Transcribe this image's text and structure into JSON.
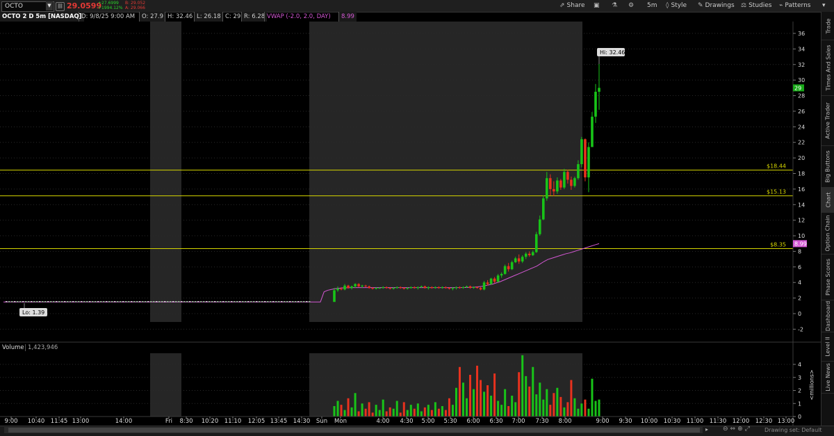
{
  "toolbar": {
    "symbol": "OCTO",
    "last_price": "29.0599",
    "net_change": "+27.6999",
    "net_change_pct": "+1994.12%",
    "bid": "B: 29.052",
    "ask": "A: 29.066",
    "share_label": "Share",
    "timeframe_label": "5m",
    "style_label": "Style",
    "drawings_label": "Drawings",
    "studies_label": "Studies",
    "patterns_label": "Patterns"
  },
  "info": {
    "title": "OCTO 2 D 5m [NASDAQ]",
    "datetime": "D: 9/8/25 9:00 AM",
    "open": "O: 27.9",
    "high": "H: 32.46",
    "low": "L: 26.18",
    "close": "C: 29",
    "range": "R: 6.28",
    "vwap_label": "VWAP (-2.0, 2.0, DAY)",
    "vwap_value": "8.99"
  },
  "right_tabs": [
    "Trade",
    "Times And Sales",
    "Active Trader",
    "Big Buttons",
    "Chart",
    "Option Chain",
    "Phase Scores",
    "Dashboard",
    "Level II",
    "Live News"
  ],
  "active_tab": "Chart",
  "colors": {
    "up": "#18c418",
    "down": "#e8321e",
    "vwap": "#d457d4",
    "level": "#d6d600",
    "grid": "#2a2a2a",
    "shade": "#262626"
  },
  "chart_data": {
    "type": "candlestick",
    "symbol": "OCTO",
    "timeframe": "2 D 5m",
    "ylim": [
      -3,
      37
    ],
    "y_ticks": [
      "-2",
      "0",
      "2",
      "4",
      "6",
      "8",
      "10",
      "12",
      "14",
      "16",
      "18",
      "20",
      "22",
      "24",
      "26",
      "28",
      "30",
      "32",
      "34",
      "36"
    ],
    "x_ticks": [
      "9:00",
      "10:40",
      "11:45",
      "13:00",
      "14:00",
      "Fri",
      "8:30",
      "10:20",
      "11:10",
      "12:05",
      "13:45",
      "14:30",
      "Sun",
      "Mon",
      "4:00",
      "4:30",
      "5:00",
      "5:30",
      "6:00",
      "6:30",
      "7:00",
      "7:30",
      "8:00",
      "9:00",
      "9:30",
      "10:00",
      "10:30",
      "11:00",
      "11:30",
      "12:00",
      "12:30",
      "13:00"
    ],
    "price_levels": [
      {
        "label": "$18.44",
        "value": 18.44
      },
      {
        "label": "$15.13",
        "value": 15.13
      },
      {
        "label": "$8.35",
        "value": 8.35
      }
    ],
    "current_price_label": "29",
    "vwap_label": "8.99",
    "high_label": "Hi: 32.46",
    "low_label": "Lo: 1.39",
    "candles": [
      [
        1.5,
        3.3,
        1.6,
        3.0
      ],
      [
        3.0,
        3.5,
        2.8,
        3.2
      ],
      [
        3.2,
        3.4,
        3.0,
        3.1
      ],
      [
        3.1,
        3.8,
        3.0,
        3.6
      ],
      [
        3.6,
        3.7,
        3.2,
        3.3
      ],
      [
        3.3,
        3.6,
        3.1,
        3.5
      ],
      [
        3.5,
        3.9,
        3.3,
        3.8
      ],
      [
        3.8,
        3.9,
        3.4,
        3.5
      ],
      [
        3.5,
        3.7,
        3.3,
        3.6
      ],
      [
        3.6,
        3.7,
        3.4,
        3.5
      ],
      [
        3.5,
        3.6,
        3.2,
        3.3
      ],
      [
        3.3,
        3.4,
        3.1,
        3.2
      ],
      [
        3.2,
        3.4,
        3.1,
        3.3
      ],
      [
        3.3,
        3.4,
        3.2,
        3.3
      ],
      [
        3.3,
        3.5,
        3.2,
        3.4
      ],
      [
        3.4,
        3.5,
        3.2,
        3.3
      ],
      [
        3.3,
        3.4,
        3.1,
        3.2
      ],
      [
        3.2,
        3.4,
        3.1,
        3.3
      ],
      [
        3.3,
        3.5,
        3.2,
        3.4
      ],
      [
        3.4,
        3.5,
        3.2,
        3.3
      ],
      [
        3.3,
        3.4,
        3.1,
        3.2
      ],
      [
        3.2,
        3.4,
        3.1,
        3.3
      ],
      [
        3.3,
        3.5,
        3.2,
        3.4
      ],
      [
        3.4,
        3.5,
        3.2,
        3.3
      ],
      [
        3.3,
        3.5,
        3.1,
        3.4
      ],
      [
        3.4,
        3.6,
        3.3,
        3.5
      ],
      [
        3.5,
        3.6,
        3.2,
        3.3
      ],
      [
        3.3,
        3.5,
        3.1,
        3.4
      ],
      [
        3.4,
        3.5,
        3.2,
        3.3
      ],
      [
        3.3,
        3.5,
        3.2,
        3.4
      ],
      [
        3.4,
        3.5,
        3.2,
        3.3
      ],
      [
        3.3,
        3.5,
        3.2,
        3.4
      ],
      [
        3.4,
        3.5,
        3.2,
        3.3
      ],
      [
        3.3,
        3.4,
        3.1,
        3.2
      ],
      [
        3.2,
        3.4,
        3.0,
        3.3
      ],
      [
        3.3,
        3.5,
        3.1,
        3.4
      ],
      [
        3.4,
        3.5,
        3.2,
        3.3
      ],
      [
        3.3,
        3.5,
        3.2,
        3.4
      ],
      [
        3.4,
        3.6,
        3.3,
        3.5
      ],
      [
        3.5,
        3.6,
        3.2,
        3.3
      ],
      [
        3.3,
        3.5,
        3.2,
        3.4
      ],
      [
        3.4,
        3.5,
        3.2,
        3.3
      ],
      [
        3.3,
        3.4,
        3.0,
        3.1
      ],
      [
        3.1,
        4.2,
        3.0,
        4.0
      ],
      [
        4.0,
        4.3,
        3.6,
        3.8
      ],
      [
        3.8,
        4.6,
        3.7,
        4.5
      ],
      [
        4.5,
        4.7,
        3.9,
        4.1
      ],
      [
        4.1,
        5.1,
        4.0,
        4.9
      ],
      [
        4.9,
        5.3,
        4.6,
        5.1
      ],
      [
        5.1,
        6.3,
        5.0,
        6.1
      ],
      [
        6.1,
        6.5,
        5.4,
        5.7
      ],
      [
        5.7,
        6.8,
        5.6,
        6.6
      ],
      [
        6.6,
        7.3,
        6.5,
        7.1
      ],
      [
        7.1,
        7.6,
        6.4,
        6.7
      ],
      [
        6.7,
        7.5,
        6.5,
        7.3
      ],
      [
        7.3,
        7.9,
        7.0,
        7.7
      ],
      [
        7.7,
        8.0,
        7.3,
        7.5
      ],
      [
        7.5,
        8.1,
        7.4,
        7.9
      ],
      [
        7.9,
        10.5,
        7.8,
        10.2
      ],
      [
        10.2,
        12.6,
        10.0,
        12.1
      ],
      [
        12.1,
        15.2,
        12.0,
        14.8
      ],
      [
        14.8,
        18.2,
        14.5,
        17.4
      ],
      [
        17.4,
        17.9,
        15.2,
        16.0
      ],
      [
        16.0,
        17.0,
        15.1,
        15.7
      ],
      [
        15.7,
        17.5,
        15.4,
        17.1
      ],
      [
        17.1,
        17.3,
        15.9,
        16.2
      ],
      [
        16.2,
        18.6,
        16.0,
        18.2
      ],
      [
        18.2,
        18.5,
        16.7,
        17.2
      ],
      [
        17.2,
        17.6,
        15.9,
        16.4
      ],
      [
        16.4,
        17.6,
        16.2,
        17.4
      ],
      [
        17.4,
        19.7,
        17.2,
        19.2
      ],
      [
        19.2,
        22.7,
        18.8,
        22.4
      ],
      [
        22.4,
        22.5,
        17.0,
        17.5
      ],
      [
        17.5,
        22.0,
        15.6,
        21.4
      ],
      [
        21.4,
        25.9,
        22.6,
        25.3
      ],
      [
        25.3,
        29.5,
        24.5,
        28.5
      ],
      [
        28.5,
        32.46,
        26.18,
        29.0
      ]
    ],
    "vwap": [
      1.5,
      2.8,
      3.0,
      3.1,
      3.2,
      3.25,
      3.3,
      3.32,
      3.33,
      3.34,
      3.34,
      3.34,
      3.34,
      3.34,
      3.34,
      3.34,
      3.34,
      3.34,
      3.34,
      3.34,
      3.34,
      3.34,
      3.34,
      3.34,
      3.34,
      3.34,
      3.34,
      3.34,
      3.34,
      3.34,
      3.34,
      3.34,
      3.34,
      3.34,
      3.34,
      3.34,
      3.34,
      3.34,
      3.34,
      3.35,
      3.36,
      3.37,
      3.4,
      3.45,
      3.5,
      3.6,
      3.7,
      3.8,
      3.95,
      4.1,
      4.3,
      4.5,
      4.7,
      4.9,
      5.1,
      5.3,
      5.5,
      5.7,
      5.9,
      6.1,
      6.4,
      6.7,
      6.95,
      7.1,
      7.25,
      7.4,
      7.55,
      7.7,
      7.8,
      7.95,
      8.1,
      8.25,
      8.4,
      8.55,
      8.7,
      8.85,
      8.99
    ],
    "volume": {
      "title": "Volume",
      "value": "1,423,946",
      "units": "<millions>",
      "y_ticks": [
        "0",
        "1",
        "2",
        "3",
        "4"
      ],
      "ylim": [
        0,
        4.8
      ],
      "bars": [
        0.8,
        1.2,
        0.9,
        0.5,
        1.4,
        0.7,
        1.8,
        0.4,
        1.0,
        0.6,
        1.1,
        0.3,
        0.9,
        0.5,
        1.3,
        0.4,
        0.7,
        0.6,
        1.2,
        0.3,
        1.1,
        0.5,
        0.9,
        0.6,
        1.0,
        0.4,
        0.7,
        0.9,
        0.5,
        1.1,
        0.6,
        0.8,
        0.5,
        1.4,
        0.9,
        2.2,
        3.8,
        2.6,
        1.4,
        3.2,
        2.1,
        3.9,
        2.8,
        1.9,
        2.4,
        1.6,
        3.3,
        1.2,
        0.9,
        2.1,
        0.8,
        1.6,
        1.1,
        3.4,
        4.7,
        3.1,
        2.3,
        3.8,
        1.7,
        2.6,
        1.3,
        2.1,
        0.9,
        1.8,
        2.2,
        1.5,
        0.7,
        1.1,
        2.8,
        1.4,
        0.6,
        1.0,
        1.3,
        0.6,
        2.9,
        1.2,
        1.3
      ]
    }
  }
}
